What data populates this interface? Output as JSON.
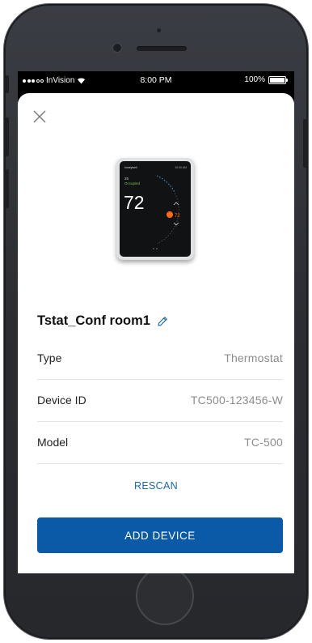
{
  "status_bar": {
    "carrier": "InVision",
    "time": "8:00 PM",
    "battery": "100%",
    "battery_level": 1.0
  },
  "device_preview": {
    "brand": "honeywell",
    "time": "10:30 AM",
    "outdoor_temp": "25",
    "mode": "Occupied",
    "indoor_temp": "72",
    "setpoint": "72"
  },
  "device": {
    "name": "Tstat_Conf room1",
    "fields": [
      {
        "label": "Type",
        "value": "Thermostat"
      },
      {
        "label": "Device ID",
        "value": "TC500-123456-W"
      },
      {
        "label": "Model",
        "value": "TC-500"
      }
    ]
  },
  "actions": {
    "rescan_label": "RESCAN",
    "add_device_label": "ADD DEVICE"
  },
  "colors": {
    "primary": "#0b5aa8",
    "link": "#1769b3",
    "accent_orange": "#ff6a13"
  }
}
